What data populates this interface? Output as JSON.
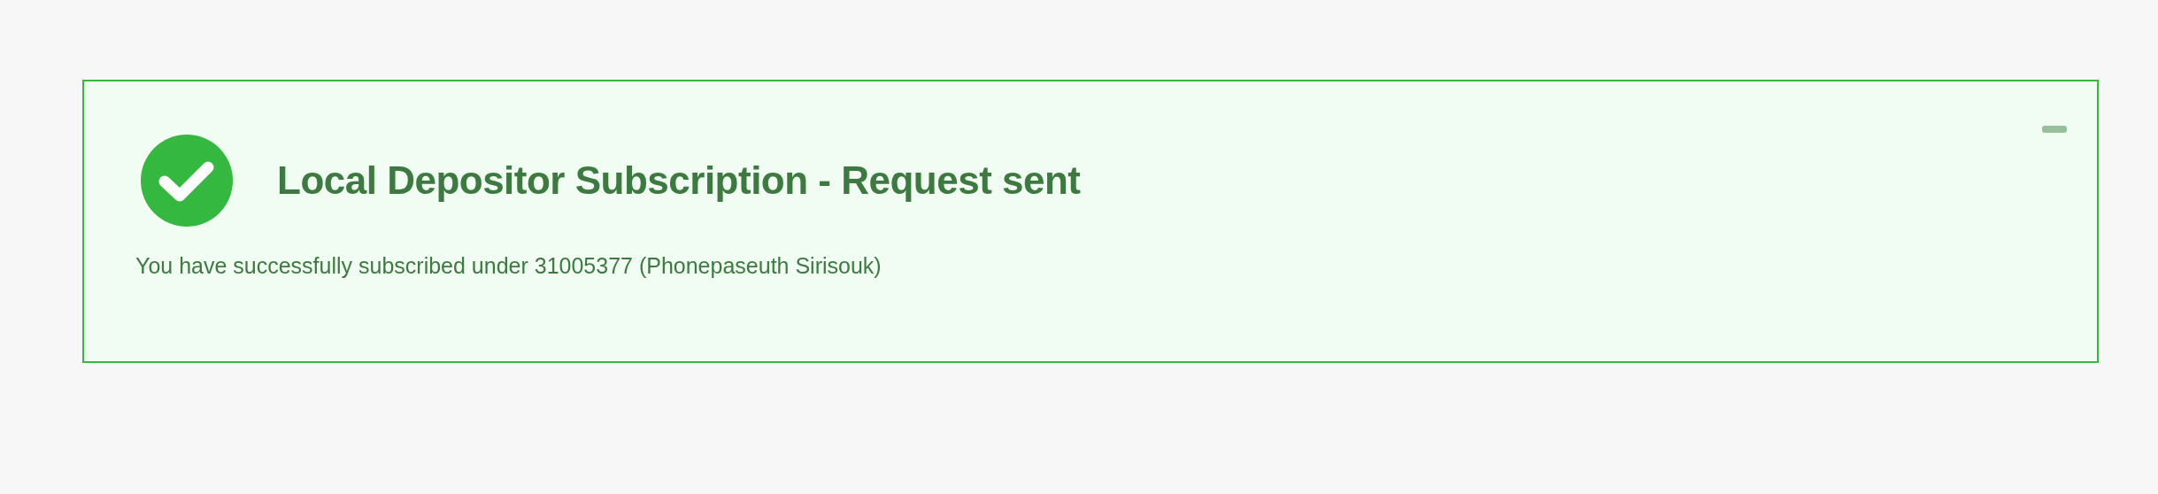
{
  "alert": {
    "title": "Local Depositor Subscription - Request sent",
    "message": "You have successfully subscribed under 31005377 (Phonepaseuth Sirisouk)",
    "collapsed": false
  }
}
